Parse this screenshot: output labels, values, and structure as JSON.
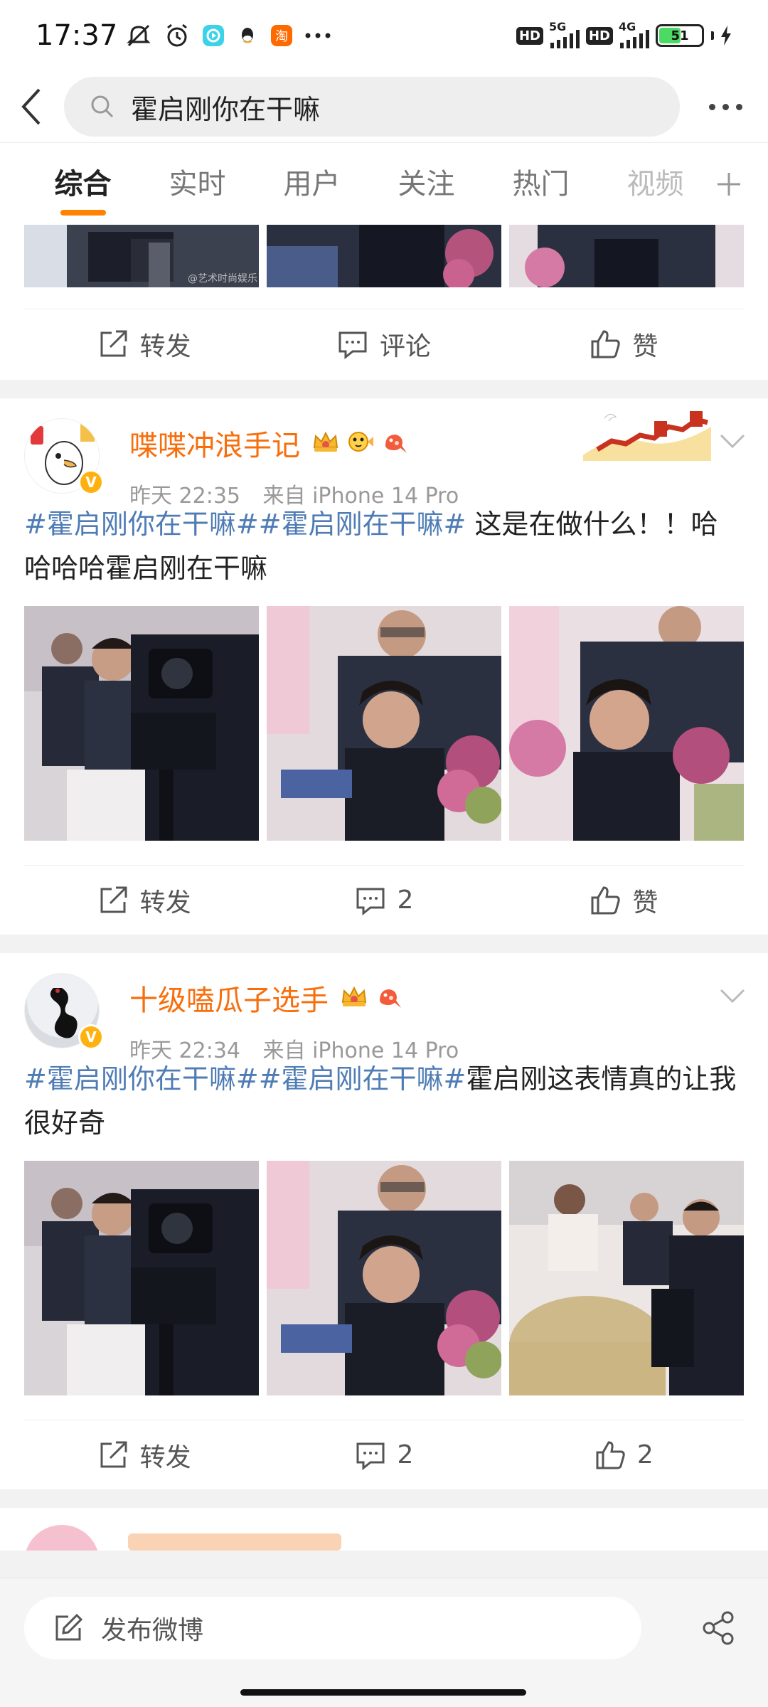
{
  "status_bar": {
    "time": "17:37",
    "net1": "5G",
    "net2": "4G",
    "hd": "HD",
    "battery": "51",
    "battery_level": 0.51
  },
  "search": {
    "query": "霍启刚你在干嘛"
  },
  "tabs": [
    {
      "label": "综合",
      "active": true
    },
    {
      "label": "实时"
    },
    {
      "label": "用户"
    },
    {
      "label": "关注"
    },
    {
      "label": "热门"
    },
    {
      "label": "视频"
    }
  ],
  "first_card": {
    "repost_label": "转发",
    "comment_label": "评论",
    "like_label": "赞",
    "watermark": "@艺术时尚娱乐"
  },
  "posts": [
    {
      "user": "喋喋冲浪手记",
      "time": "昨天 22:35",
      "source": "来自 iPhone 14 Pro",
      "topic1": "#霍启刚你在干嘛#",
      "topic2": "#霍启刚在干嘛#",
      "text_tail": " 这是在做什么！！哈哈哈哈霍启刚在干嘛",
      "repost_label": "转发",
      "comments": "2",
      "like_label": "赞"
    },
    {
      "user": "十级嗑瓜子选手",
      "time": "昨天 22:34",
      "source": "来自 iPhone 14 Pro",
      "topic1": "#霍启刚你在干嘛#",
      "topic2": "#霍启刚在干嘛#",
      "text_tail": "霍启刚这表情真的让我很好奇",
      "repost_label": "转发",
      "comments": "2",
      "likes": "2"
    }
  ],
  "bottom_bar": {
    "compose_label": "发布微博"
  },
  "colors": {
    "accent": "#ff8200",
    "username": "#f86e0c",
    "topic": "#4f7cb5",
    "verify": "#ffb20f"
  }
}
